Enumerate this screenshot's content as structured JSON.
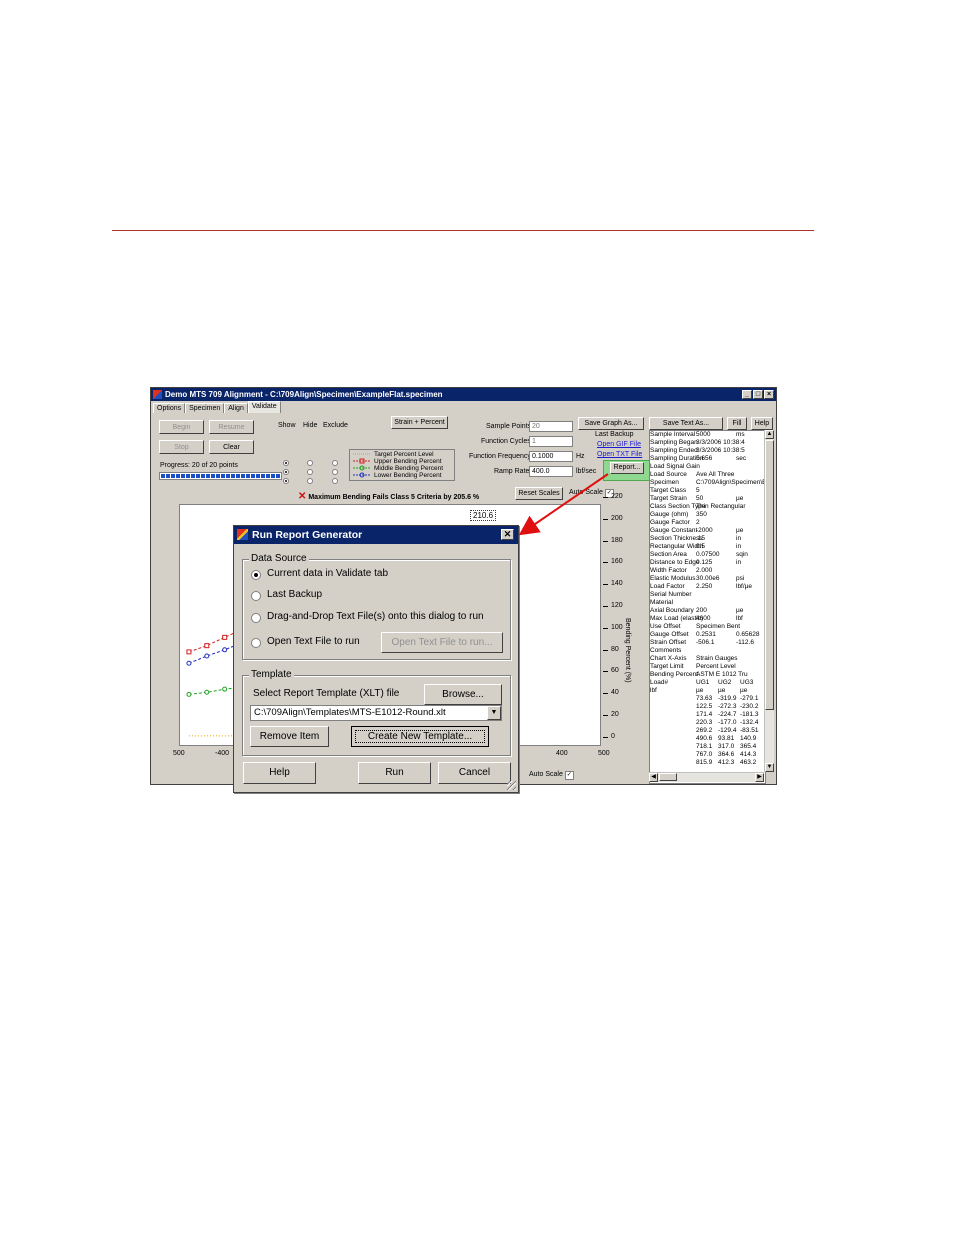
{
  "app": {
    "title": "Demo MTS 709 Alignment - C:\\709Align\\Specimen\\ExampleFlat.specimen",
    "tabs": [
      "Options",
      "Specimen",
      "Align",
      "Validate"
    ],
    "buttons": {
      "begin": "Begin",
      "resume": "Resume",
      "stop": "Stop",
      "clear": "Clear",
      "strain_percent": "Strain + Percent",
      "save_graph": "Save Graph As...",
      "save_text": "Save Text As...",
      "fill": "Fill",
      "help": "Help",
      "report": "Report...",
      "reset_scales": "Reset Scales"
    },
    "progress": {
      "text": "Progress: 20 of 20 points",
      "fraction": 1.0
    },
    "columns": {
      "show": "Show",
      "hide": "Hide",
      "exclude": "Exclude"
    },
    "legend": [
      "Target Percent Level",
      "Upper Bending Percent",
      "Middle Bending Percent",
      "Lower Bending Percent"
    ],
    "fields": {
      "sample_points_label": "Sample Points",
      "sample_points": "20",
      "function_cycles_label": "Function Cycles",
      "function_cycles": "1",
      "function_frequency_label": "Function Frequency",
      "function_frequency": "0.1000",
      "function_frequency_unit": "Hz",
      "ramp_rate_label": "Ramp Rate",
      "ramp_rate": "400.0",
      "ramp_rate_unit": "lbf/sec"
    },
    "last_backup": {
      "label": "Last Backup",
      "open_gif": "Open GIF File",
      "open_txt": "Open TXT File"
    },
    "fail_message": "Maximum Bending Fails Class 5 Criteria by 205.6 %",
    "auto_scale": "Auto Scale",
    "chart_peak_label": "210.6",
    "chart_y_axis_label": "Bending Percent (%)",
    "chart_y_ticks": [
      "220",
      "200",
      "180",
      "160",
      "140",
      "120",
      "100",
      "80",
      "60",
      "40",
      "20",
      "0"
    ],
    "chart_x_ticks": [
      "500",
      "-400",
      "400",
      "500"
    ],
    "info_panel": [
      [
        "Sample Interval",
        "5000",
        "ms"
      ],
      [
        "Sampling Began",
        "3/3/2006 10:38:4",
        ""
      ],
      [
        "Sampling Ended",
        "3/3/2006 10:38:5",
        ""
      ],
      [
        "Sampling Duration",
        "5.656",
        "sec"
      ],
      [
        "Load Signal Gain",
        "",
        ""
      ],
      [
        "Load Source",
        "Ave All Three",
        ""
      ],
      [
        "Specimen",
        "C:\\709Align\\Specimen\\Exar",
        ""
      ],
      [
        "Target Class",
        "5",
        ""
      ],
      [
        "Target Strain",
        "50",
        "µe"
      ],
      [
        "Class Section Type",
        "Thin Rectangular",
        ""
      ],
      [
        "Gauge (ohm)",
        "350",
        ""
      ],
      [
        "Gauge Factor",
        "2",
        ""
      ],
      [
        "Gauge Constant",
        "-2000",
        "µe"
      ],
      [
        "Section Thickness",
        ".15",
        "in"
      ],
      [
        "Rectangular Width",
        "0.5",
        "in"
      ],
      [
        "Section Area",
        "0.07500",
        "sqin"
      ],
      [
        "Distance to Edge",
        "0.125",
        "in"
      ],
      [
        "Width Factor",
        "2.000",
        ""
      ],
      [
        "Elastic Modulus",
        "30.00e6",
        "psi"
      ],
      [
        "Load Factor",
        "2.250",
        "lbf/µe"
      ],
      [
        "Serial Number",
        "",
        ""
      ],
      [
        "Material",
        "",
        ""
      ],
      [
        "Axial Boundary",
        "200",
        "µe"
      ],
      [
        "Max Load (elastic)",
        "4600",
        "lbf"
      ],
      [
        "Use Offset",
        "Specimen Bent",
        ""
      ],
      [
        "Gauge Offset",
        "0.2531",
        "0.65628"
      ],
      [
        "Strain Offset",
        "-506.1",
        "-112.6"
      ],
      [
        "Comments",
        "",
        ""
      ],
      [
        "Chart X-Axis",
        "Strain Gauges",
        ""
      ],
      [
        "Target Limit",
        "Percent Level",
        ""
      ],
      [
        "Bending Percent",
        "ASTM E 1012 Tru",
        ""
      ],
      [
        "Load#",
        "UG1",
        "UG2",
        "UG3"
      ],
      [
        "lbf",
        "µe",
        "µe",
        "µe"
      ],
      [
        "",
        "73.63",
        "-319.9",
        "-279.1"
      ],
      [
        "",
        "122.5",
        "-272.3",
        "-230.2"
      ],
      [
        "",
        "171.4",
        "-224.7",
        "-181.3"
      ],
      [
        "",
        "220.3",
        "-177.0",
        "-132.4"
      ],
      [
        "",
        "269.2",
        "-129.4",
        "-83.51"
      ],
      [
        "",
        "490.6",
        "93.81",
        "140.9"
      ],
      [
        "",
        "718.1",
        "317.0",
        "365.4"
      ],
      [
        "",
        "767.0",
        "364.6",
        "414.3"
      ],
      [
        "",
        "815.9",
        "412.3",
        "463.2"
      ]
    ]
  },
  "dialog": {
    "title": "Run Report Generator",
    "data_source_label": "Data Source",
    "options": [
      "Current data in Validate tab",
      "Last Backup",
      "Drag-and-Drop Text File(s) onto this dialog to run",
      "Open Text File to run"
    ],
    "open_text_button": "Open Text File to run...",
    "template_label": "Template",
    "select_template_label": "Select Report Template (XLT) file",
    "browse": "Browse...",
    "template_path": "C:\\709Align\\Templates\\MTS-E1012-Round.xlt",
    "remove_item": "Remove Item",
    "create_template": "Create New Template...",
    "help": "Help",
    "run": "Run",
    "cancel": "Cancel"
  },
  "chart_data": {
    "type": "line",
    "title": "",
    "ylabel": "Bending Percent (%)",
    "ylim": [
      0,
      220
    ],
    "series": [
      {
        "name": "Upper Bending Percent",
        "color": "#d02020",
        "x": [
          -500,
          -460,
          -420,
          -380
        ],
        "values": [
          86,
          92,
          100,
          108
        ]
      },
      {
        "name": "Middle Bending Percent",
        "color": "#20a020",
        "x": [
          -500,
          -460,
          -420,
          -380
        ],
        "values": [
          45,
          47,
          50,
          52
        ]
      },
      {
        "name": "Lower Bending Percent",
        "color": "#2030c0",
        "x": [
          -500,
          -460,
          -420,
          -380
        ],
        "values": [
          75,
          82,
          88,
          95
        ]
      },
      {
        "name": "Target Percent Level",
        "color": "#f0a000",
        "x": [
          -500,
          -380
        ],
        "values": [
          5,
          5
        ]
      }
    ]
  }
}
